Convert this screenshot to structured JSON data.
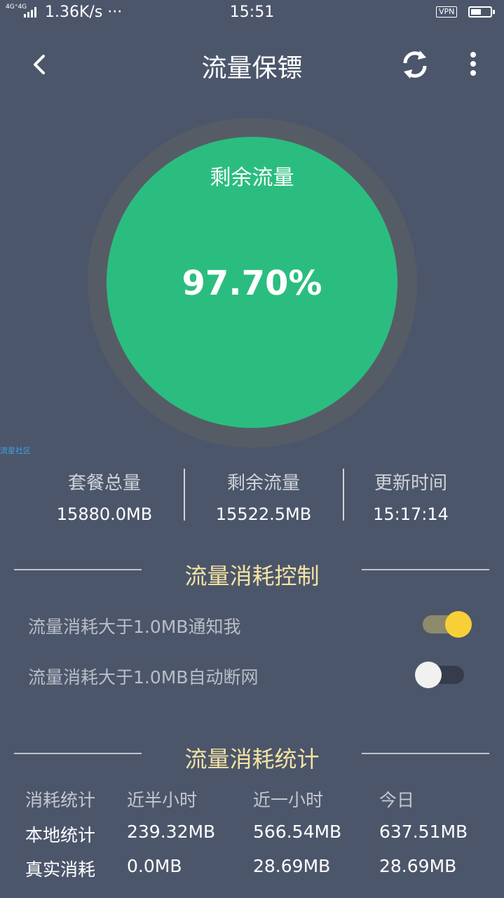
{
  "status_bar": {
    "network": "4G⁺4G",
    "speed": "1.36K/s ···",
    "time": "15:51",
    "vpn": "VPN"
  },
  "header": {
    "title": "流量保镖"
  },
  "gauge": {
    "label": "剩余流量",
    "value": "97.70%",
    "remaining_fraction": 0.977,
    "color": "#2bbd7f"
  },
  "watermark": "流星社区",
  "stats": [
    {
      "label": "套餐总量",
      "value": "15880.0MB"
    },
    {
      "label": "剩余流量",
      "value": "15522.5MB"
    },
    {
      "label": "更新时间",
      "value": "15:17:14"
    }
  ],
  "control_section": {
    "title": "流量消耗控制",
    "items": [
      {
        "label": "流量消耗大于1.0MB通知我",
        "enabled": true
      },
      {
        "label": "流量消耗大于1.0MB自动断网",
        "enabled": false
      }
    ]
  },
  "stats_section": {
    "title": "流量消耗统计",
    "columns": [
      "消耗统计",
      "近半小时",
      "近一小时",
      "今日"
    ],
    "rows": [
      [
        "本地统计",
        "239.32MB",
        "566.54MB",
        "637.51MB"
      ],
      [
        "真实消耗",
        "0.0MB",
        "28.69MB",
        "28.69MB"
      ]
    ]
  },
  "colors": {
    "background": "#4c566b",
    "accent_green": "#2bbd7f",
    "toggle_on": "#f9cf37",
    "section_title": "#f4e3a2"
  }
}
